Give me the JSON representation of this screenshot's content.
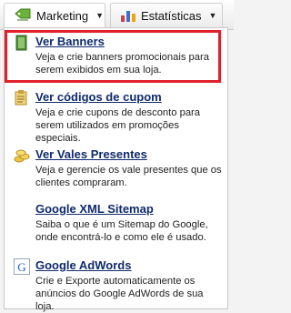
{
  "tabs": [
    {
      "label": "Marketing",
      "icon": "tag-icon"
    },
    {
      "label": "Estatísticas",
      "icon": "bar-chart-icon"
    }
  ],
  "menu": [
    {
      "title": "Ver Banners",
      "desc": "Veja e crie banners promocionais para serem exibidos em sua loja.",
      "icon": "banner-icon"
    },
    {
      "title": "Ver códigos de cupom",
      "desc": "Veja e crie cupons de desconto para serem utilizados em promoções especiais.",
      "icon": "coupon-icon"
    },
    {
      "title": "Ver Vales Presentes",
      "desc": "Veja e gerencie os vale presentes que os clientes compraram.",
      "icon": "coins-icon"
    },
    {
      "title": "Google XML Sitemap",
      "desc": "Saiba o que é um Sitemap do Google, onde encontrá-lo e como ele é usado.",
      "icon": "sitemap-icon"
    },
    {
      "title": "Google AdWords",
      "desc": "Crie e Exporte automaticamente os anúncios do Google AdWords de sua loja.",
      "icon": "google-icon"
    }
  ],
  "colors": {
    "highlight": "#e0202a",
    "link": "#0f2a6b"
  }
}
